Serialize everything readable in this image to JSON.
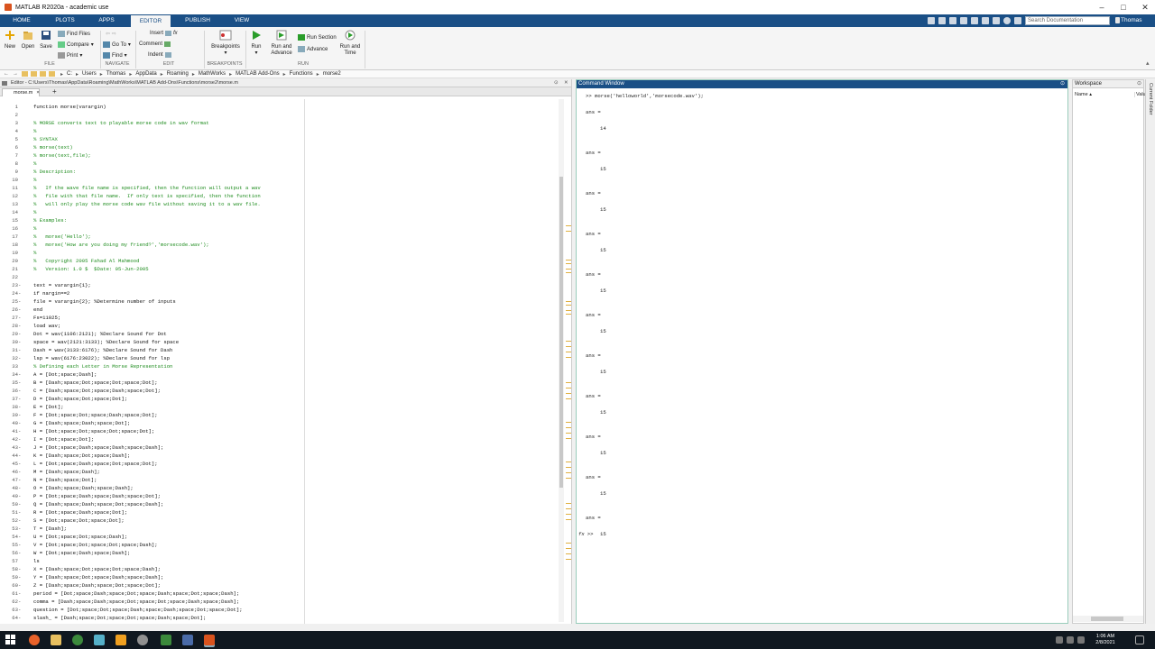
{
  "window": {
    "title": "MATLAB R2020a - academic use"
  },
  "tabs": [
    "HOME",
    "PLOTS",
    "APPS",
    "EDITOR",
    "PUBLISH",
    "VIEW"
  ],
  "search": {
    "placeholder": "Search Documentation"
  },
  "user": "Thomas",
  "ribbon": {
    "file": {
      "new": "New",
      "open": "Open",
      "save": "Save",
      "find_files": "Find Files",
      "compare": "Compare",
      "print": "Print",
      "group": "FILE"
    },
    "navigate": {
      "goto": "Go To",
      "find": "Find",
      "group": "NAVIGATE"
    },
    "edit": {
      "insert": "Insert",
      "comment": "Comment",
      "indent": "Indent",
      "fx": "fx",
      "group": "EDIT"
    },
    "breakpoints": {
      "label": "Breakpoints",
      "group": "BREAKPOINTS"
    },
    "run": {
      "run": "Run",
      "run_advance": "Run and Advance",
      "run_section": "Run Section",
      "advance": "Advance",
      "run_time": "Run and Time",
      "group": "RUN"
    }
  },
  "address": [
    "C:",
    "Users",
    "Thomas",
    "AppData",
    "Roaming",
    "MathWorks",
    "MATLAB Add-Ons",
    "Functions",
    "morse2"
  ],
  "editor": {
    "title": "Editor - C:\\Users\\Thomas\\AppData\\Roaming\\MathWorks\\MATLAB Add-Ons\\Functions\\morse2\\morse.m",
    "tab": "morse.m",
    "lines": [
      {
        "n": "1",
        "d": "",
        "t": "function morse(varargin)",
        "c": "cd"
      },
      {
        "n": "2",
        "d": "",
        "t": "",
        "c": "cd"
      },
      {
        "n": "3",
        "d": "",
        "t": "% MORSE converts text to playable morse code in wav format",
        "c": "cm"
      },
      {
        "n": "4",
        "d": "",
        "t": "%",
        "c": "cm"
      },
      {
        "n": "5",
        "d": "",
        "t": "% SYNTAX",
        "c": "cm"
      },
      {
        "n": "6",
        "d": "",
        "t": "% morse(text)",
        "c": "cm"
      },
      {
        "n": "7",
        "d": "",
        "t": "% morse(text,file);",
        "c": "cm"
      },
      {
        "n": "8",
        "d": "",
        "t": "%",
        "c": "cm"
      },
      {
        "n": "9",
        "d": "",
        "t": "% Description:",
        "c": "cm"
      },
      {
        "n": "10",
        "d": "",
        "t": "%",
        "c": "cm"
      },
      {
        "n": "11",
        "d": "",
        "t": "%   If the wave file name is specified, then the function will output a wav",
        "c": "cm"
      },
      {
        "n": "12",
        "d": "",
        "t": "%   file with that file name.  If only text is specified, then the function",
        "c": "cm"
      },
      {
        "n": "13",
        "d": "",
        "t": "%   will only play the morse code wav file without saving it to a wav file.",
        "c": "cm"
      },
      {
        "n": "14",
        "d": "",
        "t": "%",
        "c": "cm"
      },
      {
        "n": "15",
        "d": "",
        "t": "% Examples:",
        "c": "cm"
      },
      {
        "n": "16",
        "d": "",
        "t": "%",
        "c": "cm"
      },
      {
        "n": "17",
        "d": "",
        "t": "%   morse('Hello');",
        "c": "cm"
      },
      {
        "n": "18",
        "d": "",
        "t": "%   morse('How are you doing my friend?','morsecode.wav');",
        "c": "cm"
      },
      {
        "n": "19",
        "d": "",
        "t": "%",
        "c": "cm"
      },
      {
        "n": "20",
        "d": "",
        "t": "%   Copyright 2005 Fahad Al Mahmood",
        "c": "cm"
      },
      {
        "n": "21",
        "d": "",
        "t": "%   Version: 1.0 $  $Date: 05-Jun-2005",
        "c": "cm"
      },
      {
        "n": "22",
        "d": "",
        "t": "",
        "c": "cd"
      },
      {
        "n": "23",
        "d": "-",
        "t": "text = varargin{1};",
        "c": "cd"
      },
      {
        "n": "24",
        "d": "-",
        "t": "if nargin==2",
        "c": "cd"
      },
      {
        "n": "25",
        "d": "-",
        "t": "file = varargin{2}; %Determine number of inputs",
        "c": "cd"
      },
      {
        "n": "26",
        "d": "-",
        "t": "end",
        "c": "cd"
      },
      {
        "n": "27",
        "d": "-",
        "t": "Fs=11025;",
        "c": "cd"
      },
      {
        "n": "28",
        "d": "-",
        "t": "load wav;",
        "c": "cd"
      },
      {
        "n": "29",
        "d": "-",
        "t": "Dot = wav(1106:2121); %Declare Sound for Dot",
        "c": "cd"
      },
      {
        "n": "30",
        "d": "-",
        "t": "space = wav(2121:3133); %Declare Sound for space",
        "c": "cd"
      },
      {
        "n": "31",
        "d": "-",
        "t": "Dash = wav(3133:6176); %Declare Sound for Dash",
        "c": "cd"
      },
      {
        "n": "32",
        "d": "-",
        "t": "lsp = wav(6176:23022); %Declare Sound for lsp",
        "c": "cd"
      },
      {
        "n": "33",
        "d": "",
        "t": "% Defining each Letter in Morse Representation",
        "c": "cm"
      },
      {
        "n": "34",
        "d": "-",
        "t": "A = [Dot;space;Dash];",
        "c": "cd"
      },
      {
        "n": "35",
        "d": "-",
        "t": "B = [Dash;space;Dot;space;Dot;space;Dot];",
        "c": "cd"
      },
      {
        "n": "36",
        "d": "-",
        "t": "C = [Dash;space;Dot;space;Dash;space;Dot];",
        "c": "cd"
      },
      {
        "n": "37",
        "d": "-",
        "t": "D = [Dash;space;Dot;space;Dot];",
        "c": "cd"
      },
      {
        "n": "38",
        "d": "-",
        "t": "E = [Dot];",
        "c": "cd"
      },
      {
        "n": "39",
        "d": "-",
        "t": "F = [Dot;space;Dot;space;Dash;space;Dot];",
        "c": "cd"
      },
      {
        "n": "40",
        "d": "-",
        "t": "G = [Dash;space;Dash;space;Dot];",
        "c": "cd"
      },
      {
        "n": "41",
        "d": "-",
        "t": "H = [Dot;space;Dot;space;Dot;space;Dot];",
        "c": "cd"
      },
      {
        "n": "42",
        "d": "-",
        "t": "I = [Dot;space;Dot];",
        "c": "cd"
      },
      {
        "n": "43",
        "d": "-",
        "t": "J = [Dot;space;Dash;space;Dash;space;Dash];",
        "c": "cd"
      },
      {
        "n": "44",
        "d": "-",
        "t": "K = [Dash;space;Dot;space;Dash];",
        "c": "cd"
      },
      {
        "n": "45",
        "d": "-",
        "t": "L = [Dot;space;Dash;space;Dot;space;Dot];",
        "c": "cd"
      },
      {
        "n": "46",
        "d": "-",
        "t": "M = [Dash;space;Dash];",
        "c": "cd"
      },
      {
        "n": "47",
        "d": "-",
        "t": "N = [Dash;space;Dot];",
        "c": "cd"
      },
      {
        "n": "48",
        "d": "-",
        "t": "O = [Dash;space;Dash;space;Dash];",
        "c": "cd"
      },
      {
        "n": "49",
        "d": "-",
        "t": "P = [Dot;space;Dash;space;Dash;space;Dot];",
        "c": "cd"
      },
      {
        "n": "50",
        "d": "-",
        "t": "Q = [Dash;space;Dash;space;Dot;space;Dash];",
        "c": "cd"
      },
      {
        "n": "51",
        "d": "-",
        "t": "R = [Dot;space;Dash;space;Dot];",
        "c": "cd"
      },
      {
        "n": "52",
        "d": "-",
        "t": "S = [Dot;space;Dot;space;Dot];",
        "c": "cd"
      },
      {
        "n": "53",
        "d": "-",
        "t": "T = [Dash];",
        "c": "cd"
      },
      {
        "n": "54",
        "d": "-",
        "t": "U = [Dot;space;Dot;space;Dash];",
        "c": "cd"
      },
      {
        "n": "55",
        "d": "-",
        "t": "V = [Dot;space;Dot;space;Dot;space;Dash];",
        "c": "cd"
      },
      {
        "n": "56",
        "d": "-",
        "t": "W = [Dot;space;Dash;space;Dash];",
        "c": "cd"
      },
      {
        "n": "57",
        "d": "",
        "t": "ls",
        "c": "cd"
      },
      {
        "n": "58",
        "d": "-",
        "t": "X = [Dash;space;Dot;space;Dot;space;Dash];",
        "c": "cd"
      },
      {
        "n": "59",
        "d": "-",
        "t": "Y = [Dash;space;Dot;space;Dash;space;Dash];",
        "c": "cd"
      },
      {
        "n": "60",
        "d": "-",
        "t": "Z = [Dash;space;Dash;space;Dot;space;Dot];",
        "c": "cd"
      },
      {
        "n": "61",
        "d": "-",
        "t": "period = [Dot;space;Dash;space;Dot;space;Dash;space;Dot;space;Dash];",
        "c": "cd"
      },
      {
        "n": "62",
        "d": "-",
        "t": "comma = [Dash;space;Dash;space;Dot;space;Dot;space;Dash;space;Dash];",
        "c": "cd"
      },
      {
        "n": "63",
        "d": "-",
        "t": "question = [Dot;space;Dot;space;Dash;space;Dash;space;Dot;space;Dot];",
        "c": "cd"
      },
      {
        "n": "64",
        "d": "-",
        "t": "slash_ = [Dash;space;Dot;space;Dot;space;Dash;space;Dot];",
        "c": "cd"
      }
    ]
  },
  "command_window": {
    "title": "Command Window",
    "first_cmd": ">> morse('helloworld','morsecode.wav');",
    "outputs": [
      {
        "label": "ans =",
        "value": "14"
      },
      {
        "label": "ans =",
        "value": "15"
      },
      {
        "label": "ans =",
        "value": "15"
      },
      {
        "label": "ans =",
        "value": "15"
      },
      {
        "label": "ans =",
        "value": "15"
      },
      {
        "label": "ans =",
        "value": "15"
      },
      {
        "label": "ans =",
        "value": "15"
      },
      {
        "label": "ans =",
        "value": "15"
      },
      {
        "label": "ans =",
        "value": "15"
      },
      {
        "label": "ans =",
        "value": "15"
      },
      {
        "label": "ans =",
        "value": "15"
      }
    ],
    "prompt": ">>",
    "fx": "fx"
  },
  "workspace": {
    "title": "Workspace",
    "col_name": "Name ▴",
    "col_value": "Valu"
  },
  "current_folder": {
    "title": "Current Folder"
  },
  "taskbar": {
    "time": "1:06 AM",
    "date": "2/8/2021"
  },
  "colors": {
    "accent": "#1a4f86",
    "comment": "#1e8c1e",
    "string": "#a020f0"
  }
}
